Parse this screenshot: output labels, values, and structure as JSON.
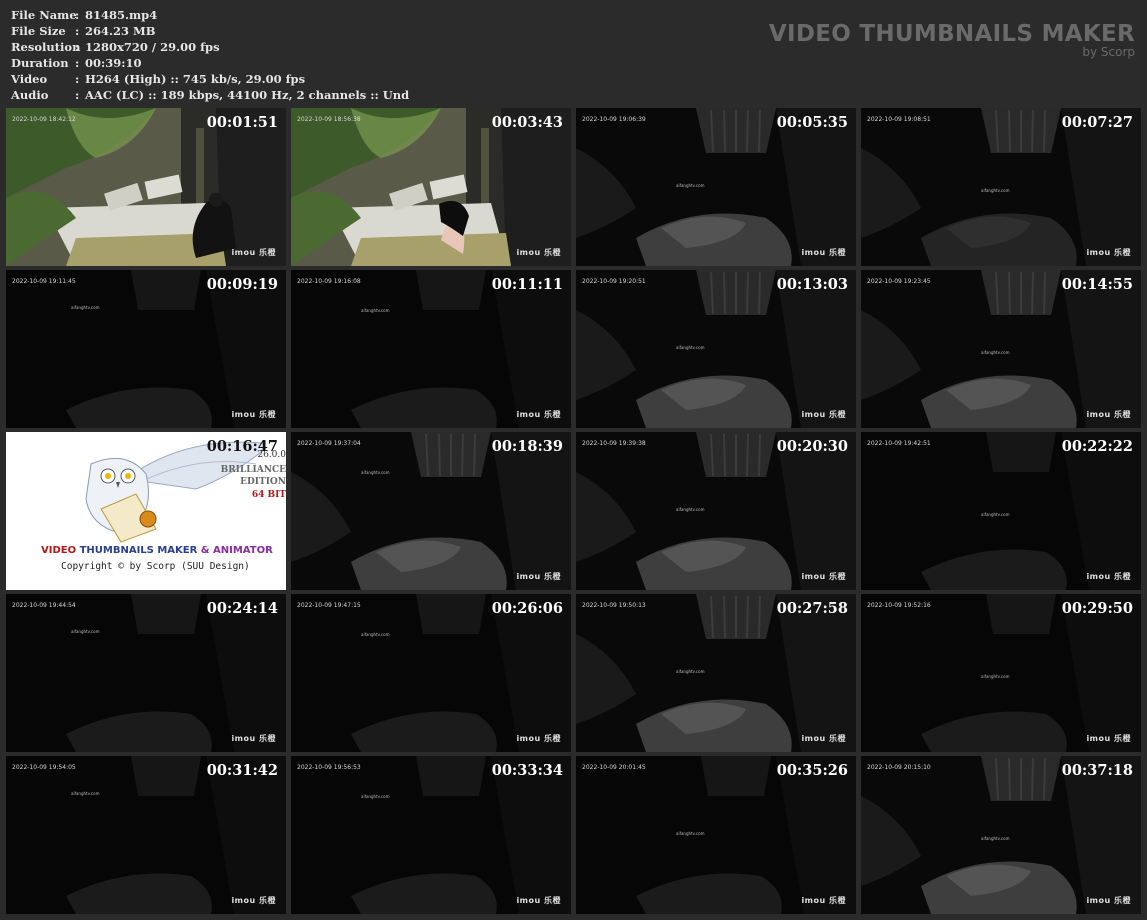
{
  "file_info": [
    {
      "label": "File Name",
      "sep": ":",
      "value": "81485.mp4"
    },
    {
      "label": "File Size",
      "sep": ":",
      "value": "264.23 MB"
    },
    {
      "label": "Resolution",
      "sep": ":",
      "value": "1280x720 / 29.00 fps"
    },
    {
      "label": "Duration",
      "sep": ":",
      "value": "00:39:10"
    },
    {
      "label": "Video",
      "sep": ":",
      "value": "H264 (High) :: 745 kb/s, 29.00 fps"
    },
    {
      "label": "Audio",
      "sep": ":",
      "value": "AAC (LC) :: 189 kbps, 44100 Hz, 2 channels :: Und"
    }
  ],
  "brand": {
    "title": "VIDEO THUMBNAILS MAKER",
    "subtitle": "by Scorp"
  },
  "thumbs": [
    {
      "time": "00:01:51",
      "cam": "2022-10-09 18:42:12",
      "logo": "imou 乐橙",
      "scene": "bright",
      "wm": ""
    },
    {
      "time": "00:03:43",
      "cam": "2022-10-09 18:56:38",
      "logo": "imou 乐橙",
      "scene": "bright2",
      "wm": ""
    },
    {
      "time": "00:05:35",
      "cam": "2022-10-09 19:06:39",
      "logo": "imou 乐橙",
      "scene": "night1",
      "wm": "aifanghtv.com"
    },
    {
      "time": "00:07:27",
      "cam": "2022-10-09 19:08:51",
      "logo": "imou 乐橙",
      "scene": "night2",
      "wm": "aifanghtv.com"
    },
    {
      "time": "00:09:19",
      "cam": "2022-10-09 19:11:45",
      "logo": "imou 乐橙",
      "scene": "dark",
      "wm": "aifanghtv.com"
    },
    {
      "time": "00:11:11",
      "cam": "2022-10-09 19:16:08",
      "logo": "imou 乐橙",
      "scene": "dark",
      "wm": "aifanghtv.com"
    },
    {
      "time": "00:13:03",
      "cam": "2022-10-09 19:20:51",
      "logo": "imou 乐橙",
      "scene": "night1",
      "wm": "aifanghtv.com"
    },
    {
      "time": "00:14:55",
      "cam": "2022-10-09 19:23:45",
      "logo": "imou 乐橙",
      "scene": "night1",
      "wm": "aifanghtv.com"
    },
    {
      "time": "00:16:47",
      "cam": "",
      "logo": "",
      "scene": "promo",
      "wm": ""
    },
    {
      "time": "00:18:39",
      "cam": "2022-10-09 19:37:04",
      "logo": "imou 乐橙",
      "scene": "night1",
      "wm": "aifanghtv.com"
    },
    {
      "time": "00:20:30",
      "cam": "2022-10-09 19:39:38",
      "logo": "imou 乐橙",
      "scene": "night1",
      "wm": "aifanghtv.com"
    },
    {
      "time": "00:22:22",
      "cam": "2022-10-09 19:42:51",
      "logo": "imou 乐橙",
      "scene": "dark",
      "wm": "aifanghtv.com"
    },
    {
      "time": "00:24:14",
      "cam": "2022-10-09 19:44:54",
      "logo": "imou 乐橙",
      "scene": "dark",
      "wm": "aifanghtv.com"
    },
    {
      "time": "00:26:06",
      "cam": "2022-10-09 19:47:15",
      "logo": "imou 乐橙",
      "scene": "dark",
      "wm": "aifanghtv.com"
    },
    {
      "time": "00:27:58",
      "cam": "2022-10-09 19:50:13",
      "logo": "imou 乐橙",
      "scene": "night1",
      "wm": "aifanghtv.com"
    },
    {
      "time": "00:29:50",
      "cam": "2022-10-09 19:52:16",
      "logo": "imou 乐橙",
      "scene": "dark",
      "wm": "aifanghtv.com"
    },
    {
      "time": "00:31:42",
      "cam": "2022-10-09 19:54:05",
      "logo": "imou 乐橙",
      "scene": "dark",
      "wm": "aifanghtv.com"
    },
    {
      "time": "00:33:34",
      "cam": "2022-10-09 19:56:53",
      "logo": "imou 乐橙",
      "scene": "dark",
      "wm": "aifanghtv.com"
    },
    {
      "time": "00:35:26",
      "cam": "2022-10-09 20:01:45",
      "logo": "imou 乐橙",
      "scene": "dark",
      "wm": "aifanghtv.com"
    },
    {
      "time": "00:37:18",
      "cam": "2022-10-09 20:15:10",
      "logo": "imou 乐橙",
      "scene": "night1",
      "wm": "aifanghtv.com"
    }
  ],
  "promo": {
    "version": "26.0.0",
    "edition_line1": "BRILLIANCE",
    "edition_line2": "EDITION",
    "bits": "64 BIT",
    "product_v1": "VIDEO",
    "product_mid": " THUMBNAILS MAKER ",
    "product_v2": "& ANIMATOR",
    "copyright": "Copyright © by Scorp (SUU Design)"
  }
}
